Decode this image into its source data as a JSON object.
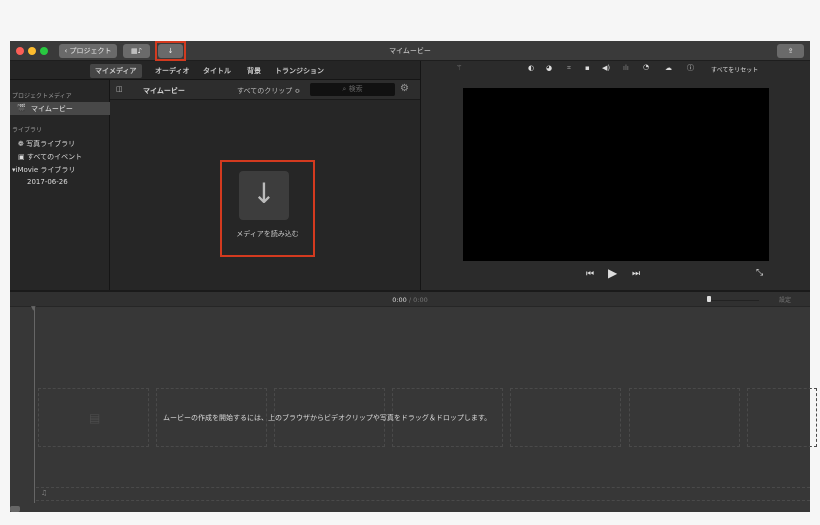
{
  "window": {
    "title": "マイムービー"
  },
  "toolbar": {
    "back_label": "プロジェクト",
    "media_icon": "film-music-icon",
    "import_icon": "down-arrow-icon",
    "share_icon": "share-icon"
  },
  "tabs": [
    {
      "label": "マイメディア",
      "active": true
    },
    {
      "label": "オーディオ"
    },
    {
      "label": "タイトル"
    },
    {
      "label": "背景"
    },
    {
      "label": "トランジション"
    }
  ],
  "sidebar": {
    "section1": "プロジェクトメディア",
    "project": "マイムービー",
    "section2": "ライブラリ",
    "photos": "写真ライブラリ",
    "events": "すべてのイベント",
    "library": "iMovie ライブラリ",
    "date": "2017-06-26"
  },
  "browser": {
    "title": "マイムービー",
    "filter": "すべてのクリップ ≎",
    "search_placeholder": "検索",
    "import_label": "メディアを読み込む"
  },
  "viewer": {
    "reset_label": "すべてをリセット"
  },
  "timeline": {
    "time_current": "0:00",
    "time_sep": " / ",
    "time_total": "0:00",
    "settings": "設定",
    "hint": "ムービーの作成を開始するには、上のブラウザからビデオクリップや写真をドラッグ＆ドロップします。",
    "zoom_level": 0.05
  },
  "colors": {
    "highlight": "#d33a1f"
  }
}
